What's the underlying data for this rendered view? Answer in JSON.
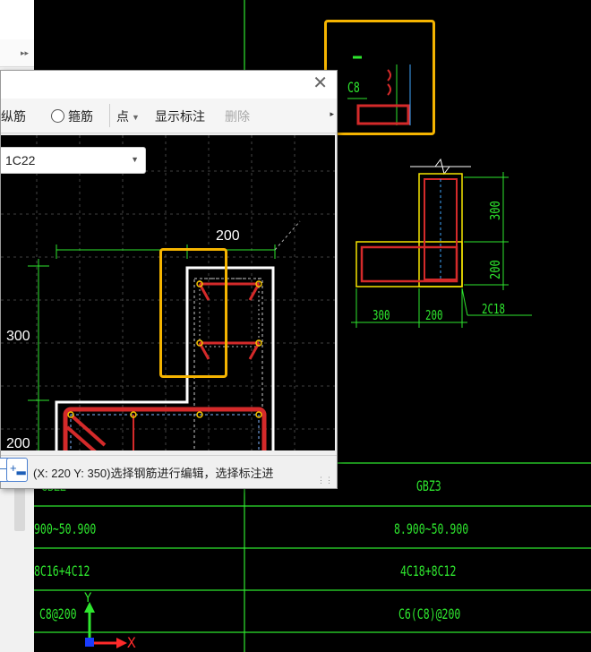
{
  "dialog": {
    "toolbar": {
      "longitudinal_rebar_label": "纵筋",
      "stirrup_label": "箍筋",
      "point_dropdown_label": "点",
      "show_annotation_label": "显示标注",
      "delete_label": "删除"
    },
    "rebar_select_value": "1C22",
    "dimensions": {
      "top_width": "200",
      "upper_height": "300",
      "lower_height": "200"
    },
    "status_text": "(X: 220 Y: 350)选择钢筋进行编辑，选择标注进"
  },
  "cad": {
    "top_detail_label": "C8",
    "section": {
      "dim_300_vertical": "300",
      "dim_200_vertical": "200",
      "dim_300_bottom": "300",
      "dim_200_bottom": "200",
      "rebar_callout": "2C18"
    },
    "table": {
      "left_column": [
        "GBZZ",
        "900~50.900",
        "8C16+4C12",
        "C8@200"
      ],
      "right_column": [
        "GBZ3",
        "8.900~50.900",
        "4C18+8C12",
        "C6(C8)@200"
      ]
    },
    "ucs": {
      "x_label": "X",
      "y_label": "Y"
    }
  },
  "colors": {
    "cad_green": "#2ee62e",
    "rebar_red": "#d42a2a",
    "highlight_yellow": "#f5b400"
  }
}
